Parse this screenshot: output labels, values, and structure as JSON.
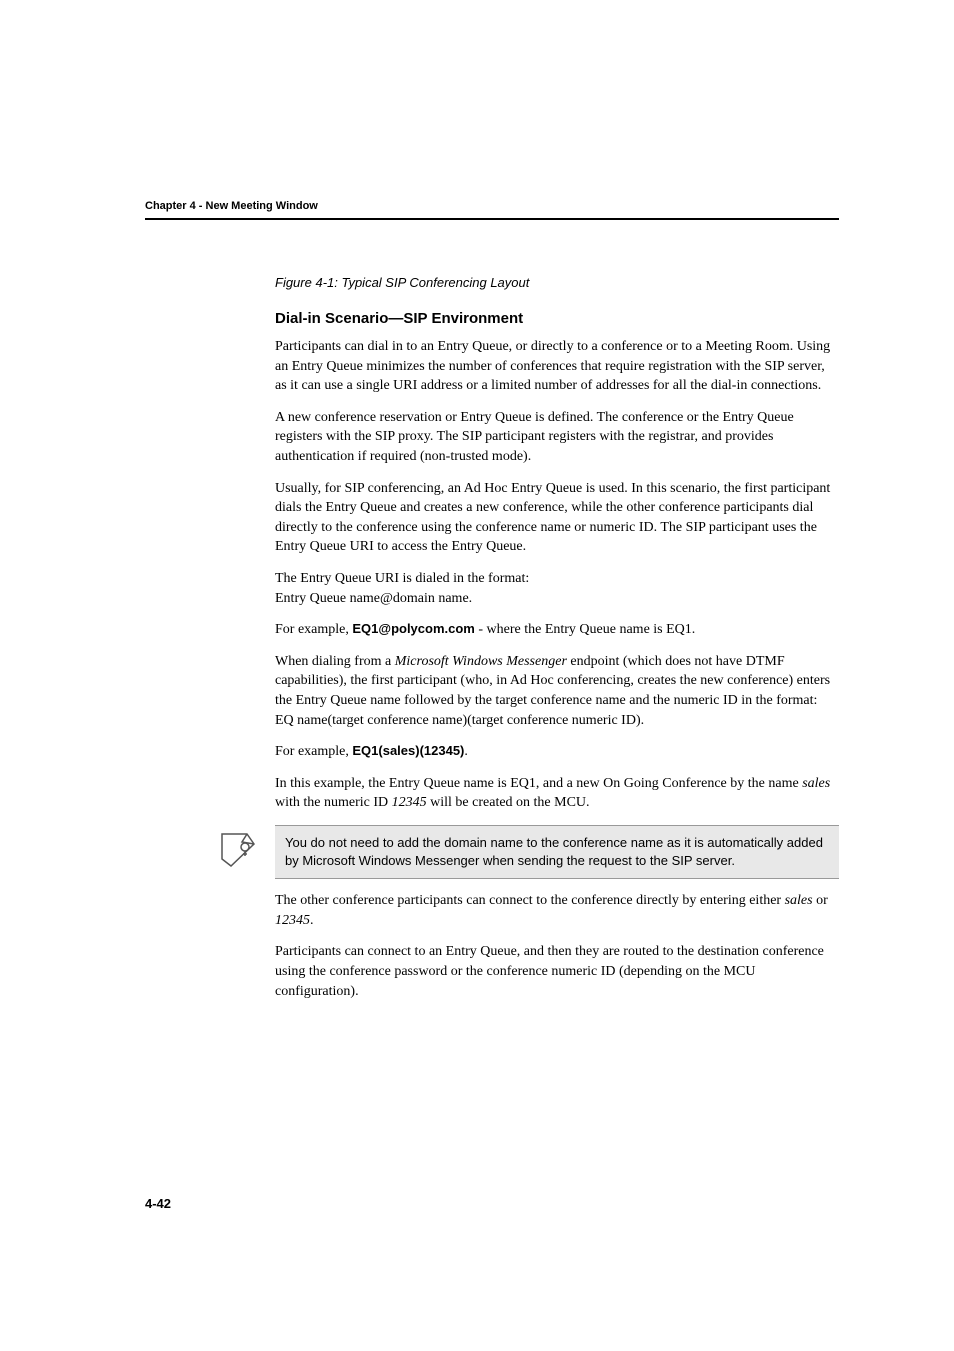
{
  "header": {
    "chapter_line": "Chapter 4 - New Meeting Window"
  },
  "figure_caption": "Figure 4-1: Typical SIP Conferencing Layout",
  "section_heading": "Dial-in Scenario—SIP Environment",
  "para1": "Participants can dial in to an Entry Queue, or directly to a conference or to a Meeting Room. Using an Entry Queue minimizes the number of conferences that require registration with the SIP server, as it can use a single URI address or a limited number of addresses for all the dial-in connections.",
  "para2": "A new conference reservation or Entry Queue is defined. The conference or the Entry Queue registers with the SIP proxy. The SIP participant registers with the registrar, and provides authentication if required (non-trusted mode).",
  "para3": "Usually, for SIP conferencing, an Ad Hoc Entry Queue is used. In this scenario, the first participant dials the Entry Queue and creates a new conference, while the other conference participants dial directly to the conference using the conference name or numeric ID. The SIP participant uses the Entry Queue URI to access the Entry Queue.",
  "para4_line1": "The Entry Queue URI is dialed in the format:",
  "para4_line2": "Entry Queue name@domain name.",
  "para5_prefix": "For example, ",
  "para5_bold": "EQ1@polycom.com",
  "para5_suffix": " - where the Entry Queue name is EQ1.",
  "para6_t1": "When dialing from a ",
  "para6_i1": "Microsoft Windows Messenger",
  "para6_t2": " endpoint (which does not have DTMF capabilities), the first participant (who, in Ad Hoc conferencing, creates the new conference) enters the Entry Queue name followed by the target conference name and the numeric ID in the format:",
  "para6_line2": "EQ name(target conference name)(target conference numeric ID).",
  "para7_prefix": "For example, ",
  "para7_bold": "EQ1(sales)(12345)",
  "para7_suffix": ".",
  "para8_t1": "In this example, the Entry Queue name is EQ1, and a new On Going Conference by the name ",
  "para8_i1": "sales",
  "para8_t2": " with the numeric ID ",
  "para8_i2": "12345",
  "para8_t3": " will be created on the MCU.",
  "note_text": "You do not need to add the domain name to the conference name as it is automatically added by Microsoft Windows Messenger when sending the request to the SIP server.",
  "para9_t1": "The other conference participants can connect to the conference directly by entering either ",
  "para9_i1": "sales",
  "para9_t2": " or ",
  "para9_i2": "12345",
  "para9_t3": ".",
  "para10": "Participants can connect to an Entry Queue, and then they are routed to the destination conference using the conference password or the conference numeric ID (depending on the MCU configuration).",
  "page_number": "4-42"
}
